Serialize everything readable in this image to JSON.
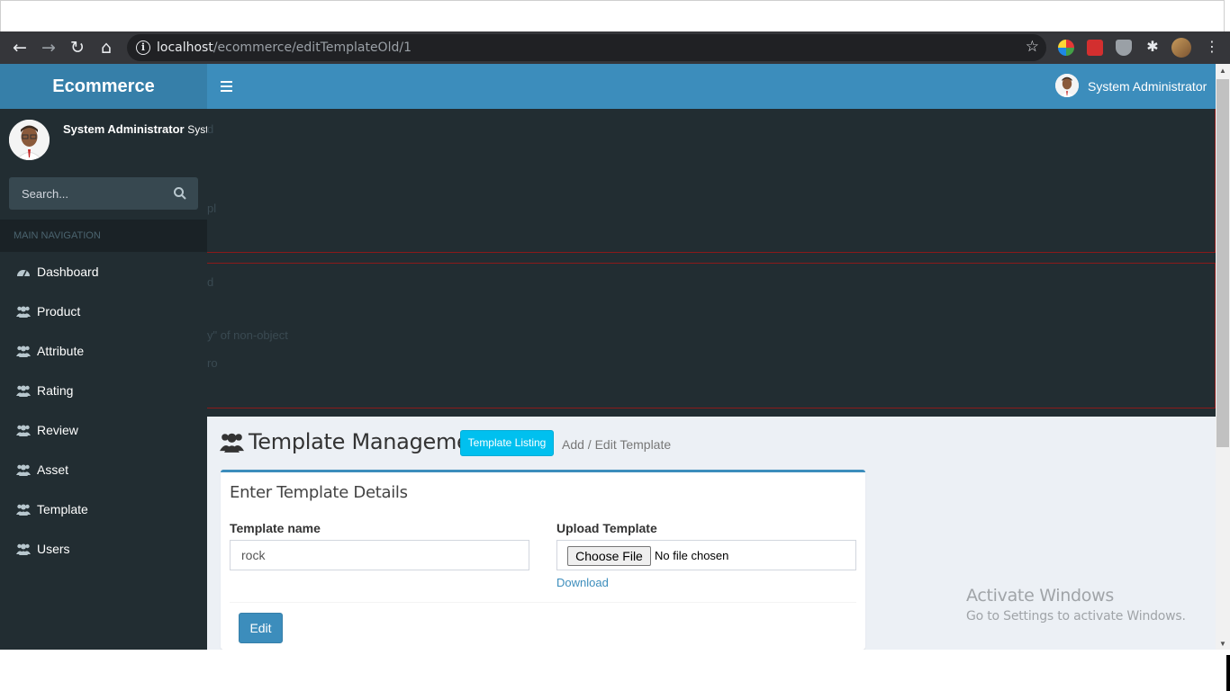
{
  "browser": {
    "url_host": "localhost",
    "url_path": "/ecommerce/editTemplateOld/1"
  },
  "app": {
    "logo": "Ecommerce",
    "header_user": "System Administrator"
  },
  "sidebar": {
    "user_name": "System Administrator",
    "user_role_clipped": "System",
    "search_placeholder": "Search...",
    "nav_header": "MAIN NAVIGATION",
    "items": [
      {
        "label": "Dashboard",
        "icon": "dashboard-icon"
      },
      {
        "label": "Product",
        "icon": "users-icon"
      },
      {
        "label": "Attribute",
        "icon": "users-icon"
      },
      {
        "label": "Rating",
        "icon": "users-icon"
      },
      {
        "label": "Review",
        "icon": "users-icon"
      },
      {
        "label": "Asset",
        "icon": "users-icon"
      },
      {
        "label": "Template",
        "icon": "users-icon"
      },
      {
        "label": "Users",
        "icon": "users-icon"
      }
    ]
  },
  "error_fragments": [
    "d",
    "pl",
    "d",
    "y\" of non-object",
    "ro"
  ],
  "content": {
    "page_title": "Template Management",
    "listing_button": "Template Listing",
    "sub_title": "Add / Edit Template",
    "box_title": "Enter Template Details",
    "template_name_label": "Template name",
    "template_name_value": "rock",
    "upload_label": "Upload Template",
    "choose_file": "Choose File",
    "file_status": "No file chosen",
    "download": "Download",
    "edit_button": "Edit"
  },
  "watermark": {
    "line1": "Activate Windows",
    "line2": "Go to Settings to activate Windows."
  },
  "colors": {
    "header": "#3c8dbc",
    "logo_bg": "#367fa9",
    "sidebar": "#222d32",
    "info_button": "#00c0ef"
  }
}
